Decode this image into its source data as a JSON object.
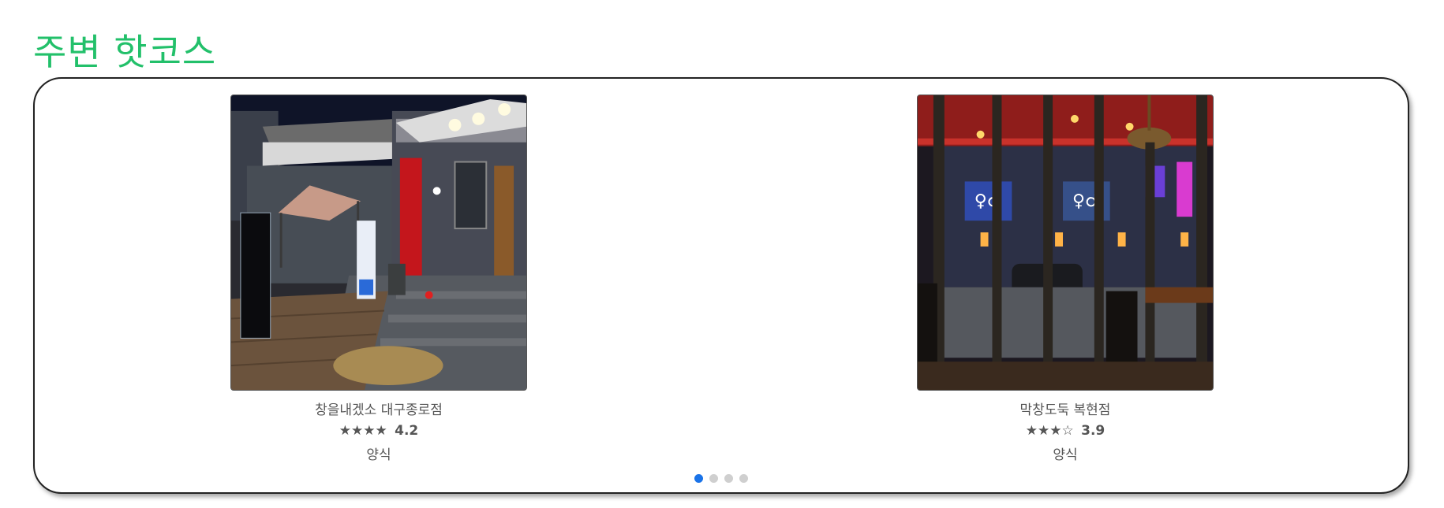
{
  "section": {
    "title": "주변 핫코스"
  },
  "carousel": {
    "cards": [
      {
        "name": "창을내겠소 대구종로점",
        "stars": "★★★★",
        "rating": "4.2",
        "category": "양식"
      },
      {
        "name": "막창도둑 복현점",
        "stars": "★★★☆",
        "rating": "3.9",
        "category": "양식"
      }
    ],
    "pagination": {
      "total": 4,
      "active_index": 0
    },
    "colors": {
      "title": "#22c06a",
      "active_dot": "#1a73e8",
      "inactive_dot": "#cfcfcf"
    }
  }
}
